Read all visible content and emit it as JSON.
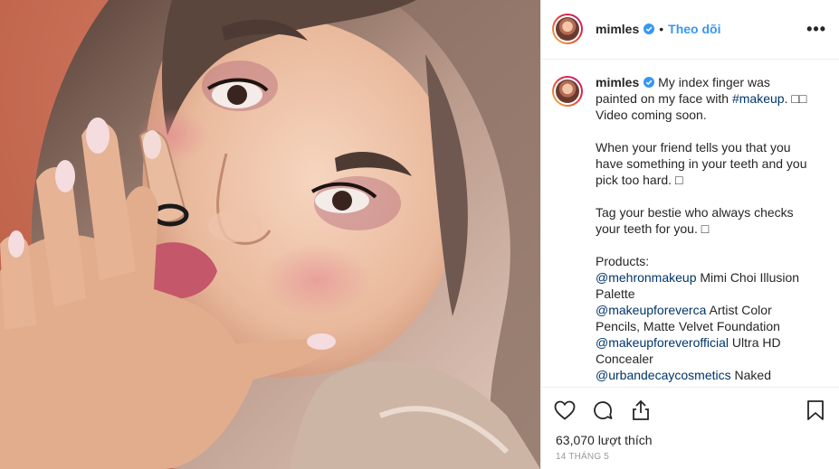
{
  "post": {
    "username": "mimles",
    "separator": "•",
    "follow_label": "Theo dõi",
    "more_label": "•••",
    "caption": {
      "line1_pre": "My index finger was painted on my face with ",
      "line1_tag": "#makeup",
      "line1_post": ". □□ Video coming soon.",
      "para2": "When your friend tells you that you have something in your teeth and you pick too hard. □",
      "para3": "Tag your bestie who always checks your teeth for you. □",
      "products_heading": "Products:",
      "mention1": "@mehronmakeup",
      "mention1_text": " Mimi Choi Illusion Palette",
      "mention2": "@makeupforeverca",
      "mention2_text": " Artist Color Pencils, Matte Velvet Foundation",
      "mention3": "@makeupforeverofficial",
      "mention3_text": " Ultra HD Concealer",
      "mention4": "@urbandecaycosmetics",
      "mention4_text": " Naked Cherry, “Grind” Glitter Eyeshadow"
    },
    "likes": "63,070 lượt thích",
    "date": "14 THÁNG 5"
  },
  "icons": {
    "like": "heart-icon",
    "comment": "comment-icon",
    "share": "share-icon",
    "save": "bookmark-icon",
    "verified": "verified-badge-icon"
  },
  "colors": {
    "accent": "#3897f0",
    "link": "#003569",
    "background_photo": "#c9694f"
  }
}
